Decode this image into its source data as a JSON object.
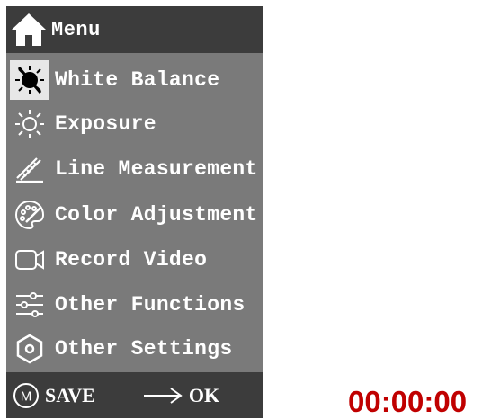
{
  "menu": {
    "title": "Menu",
    "items": [
      {
        "label": "White Balance",
        "icon": "white-balance-icon",
        "selected": true
      },
      {
        "label": "Exposure",
        "icon": "sun-icon"
      },
      {
        "label": "Line Measurement",
        "icon": "ruler-icon"
      },
      {
        "label": "Color Adjustment",
        "icon": "palette-icon"
      },
      {
        "label": "Record Video",
        "icon": "video-camera-icon"
      },
      {
        "label": "Other Functions",
        "icon": "sliders-icon"
      },
      {
        "label": "Other Settings",
        "icon": "settings-hexagon-icon"
      }
    ]
  },
  "footer": {
    "m_glyph": "M",
    "save_label": "SAVE",
    "ok_label": "OK"
  },
  "timer": "00:00:00",
  "colors": {
    "panel_bg": "#7a7a7a",
    "header_bg": "#3c3c3c",
    "selected_bg": "#e7e7e7",
    "timer_red": "#c00000"
  }
}
